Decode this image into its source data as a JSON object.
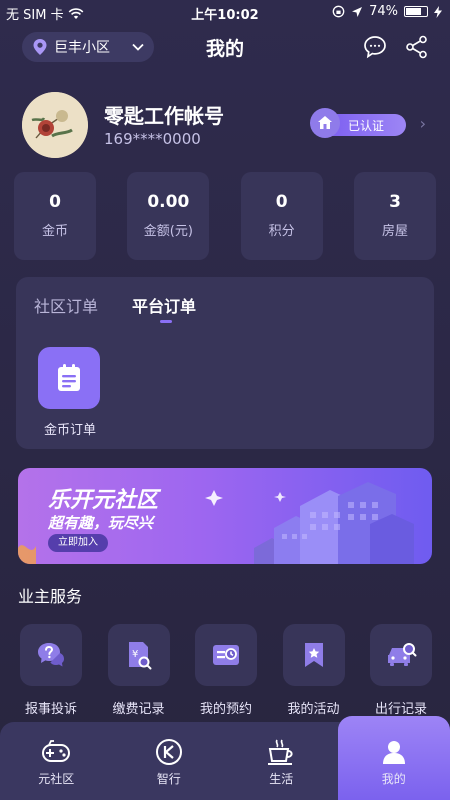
{
  "status_bar": {
    "carrier": "无 SIM 卡",
    "time": "上午10:02",
    "battery": "74%",
    "battery_level": 0.74
  },
  "header": {
    "location": "巨丰小区",
    "title": "我的"
  },
  "profile": {
    "name": "零匙工作帐号",
    "phone": "169****0000",
    "verified_label": "已认证"
  },
  "stats": [
    {
      "value": "0",
      "label": "金币"
    },
    {
      "value": "0.00",
      "label": "金额(元)"
    },
    {
      "value": "0",
      "label": "积分"
    },
    {
      "value": "3",
      "label": "房屋"
    }
  ],
  "orders": {
    "tabs": [
      {
        "label": "社区订单"
      },
      {
        "label": "平台订单"
      }
    ],
    "items": [
      {
        "label": "金币订单"
      }
    ]
  },
  "banner": {
    "title": "乐开元社区",
    "subtitle": "超有趣，玩尽兴",
    "button_label": "立即加入"
  },
  "owner_services": {
    "title": "业主服务",
    "items": [
      {
        "label": "报事投诉",
        "icon": "question-chat-icon"
      },
      {
        "label": "缴费记录",
        "icon": "bill-search-icon"
      },
      {
        "label": "我的预约",
        "icon": "appointment-icon"
      },
      {
        "label": "我的活动",
        "icon": "bookmark-star-icon"
      },
      {
        "label": "出行记录",
        "icon": "car-search-icon"
      }
    ]
  },
  "tabbar": {
    "items": [
      {
        "label": "元社区",
        "icon": "gamepad-icon"
      },
      {
        "label": "智行",
        "icon": "k-circle-icon"
      },
      {
        "label": "生活",
        "icon": "coffee-cup-icon"
      },
      {
        "label": "我的",
        "icon": "person-icon",
        "active": true
      }
    ]
  },
  "colors": {
    "background": "#2f2b4d",
    "card": "#383559",
    "accent": "#8a70f5"
  }
}
